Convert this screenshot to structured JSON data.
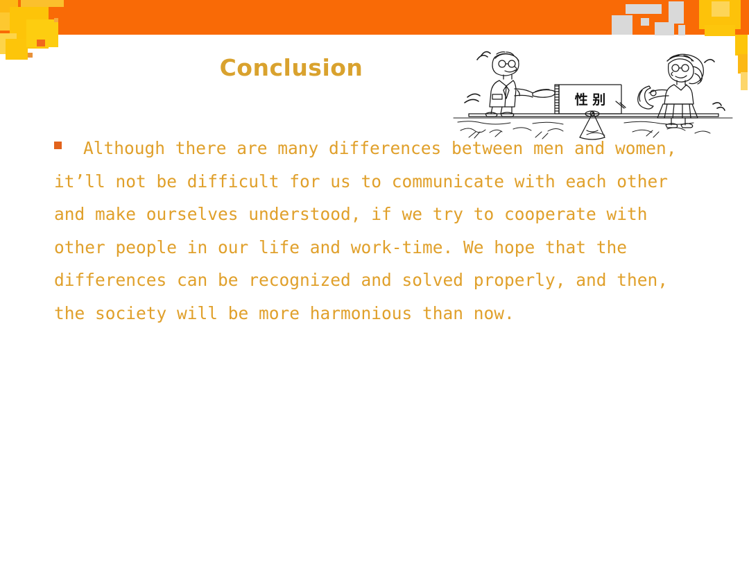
{
  "slide": {
    "title": "Conclusion",
    "title_color": "#d9a22e",
    "band_color": "#f96a06",
    "body_color": "#e0a02b",
    "bullet_color": "#e2631c",
    "background_color": "#ffffff"
  },
  "content": {
    "bullet_glyph": "■",
    "paragraph": "Although there are many differences between men and women, it’ll not be difficult for us to communicate with each other and make ourselves understood, if we try to cooperate with other people in our life and work-time. We hope that the differences can be recognized and solved properly, and then, the society will be more harmonious than now.",
    "lines": [
      "Although there are many differences",
      "between men and women, it’ll not be",
      "difficult for us to communicate with each",
      "other and make ourselves understood, if we",
      "try to cooperate with other people in our",
      "life and work-time. We hope that the",
      "differences can be recognized and solved",
      "properly, and then, the society will be more",
      "harmonious than now."
    ]
  },
  "illustration": {
    "name": "gender-balance-cartoon",
    "description": "Line drawing of a man and a woman standing on a plank balanced on a fulcrum with a signboard in the middle",
    "sign_text": "性 别",
    "figures": [
      "man-figure",
      "woman-figure"
    ]
  }
}
